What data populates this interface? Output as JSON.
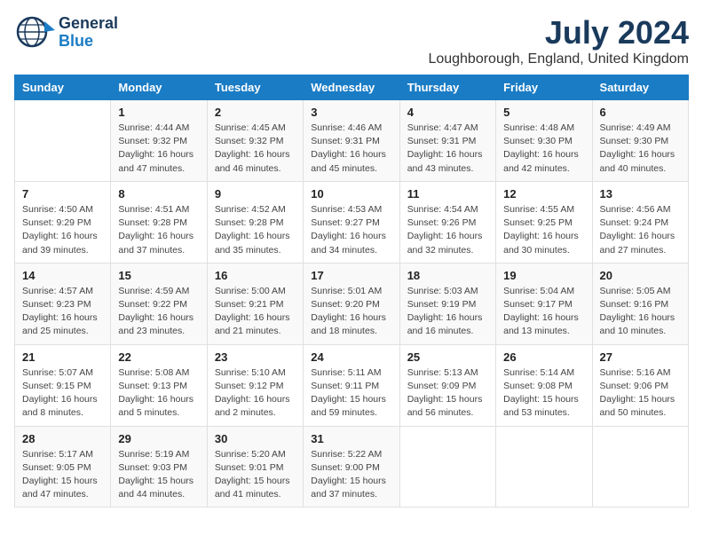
{
  "header": {
    "logo_line1": "General",
    "logo_line2": "Blue",
    "month": "July 2024",
    "location": "Loughborough, England, United Kingdom"
  },
  "days_of_week": [
    "Sunday",
    "Monday",
    "Tuesday",
    "Wednesday",
    "Thursday",
    "Friday",
    "Saturday"
  ],
  "weeks": [
    [
      {
        "day": "",
        "info": ""
      },
      {
        "day": "1",
        "info": "Sunrise: 4:44 AM\nSunset: 9:32 PM\nDaylight: 16 hours\nand 47 minutes."
      },
      {
        "day": "2",
        "info": "Sunrise: 4:45 AM\nSunset: 9:32 PM\nDaylight: 16 hours\nand 46 minutes."
      },
      {
        "day": "3",
        "info": "Sunrise: 4:46 AM\nSunset: 9:31 PM\nDaylight: 16 hours\nand 45 minutes."
      },
      {
        "day": "4",
        "info": "Sunrise: 4:47 AM\nSunset: 9:31 PM\nDaylight: 16 hours\nand 43 minutes."
      },
      {
        "day": "5",
        "info": "Sunrise: 4:48 AM\nSunset: 9:30 PM\nDaylight: 16 hours\nand 42 minutes."
      },
      {
        "day": "6",
        "info": "Sunrise: 4:49 AM\nSunset: 9:30 PM\nDaylight: 16 hours\nand 40 minutes."
      }
    ],
    [
      {
        "day": "7",
        "info": "Sunrise: 4:50 AM\nSunset: 9:29 PM\nDaylight: 16 hours\nand 39 minutes."
      },
      {
        "day": "8",
        "info": "Sunrise: 4:51 AM\nSunset: 9:28 PM\nDaylight: 16 hours\nand 37 minutes."
      },
      {
        "day": "9",
        "info": "Sunrise: 4:52 AM\nSunset: 9:28 PM\nDaylight: 16 hours\nand 35 minutes."
      },
      {
        "day": "10",
        "info": "Sunrise: 4:53 AM\nSunset: 9:27 PM\nDaylight: 16 hours\nand 34 minutes."
      },
      {
        "day": "11",
        "info": "Sunrise: 4:54 AM\nSunset: 9:26 PM\nDaylight: 16 hours\nand 32 minutes."
      },
      {
        "day": "12",
        "info": "Sunrise: 4:55 AM\nSunset: 9:25 PM\nDaylight: 16 hours\nand 30 minutes."
      },
      {
        "day": "13",
        "info": "Sunrise: 4:56 AM\nSunset: 9:24 PM\nDaylight: 16 hours\nand 27 minutes."
      }
    ],
    [
      {
        "day": "14",
        "info": "Sunrise: 4:57 AM\nSunset: 9:23 PM\nDaylight: 16 hours\nand 25 minutes."
      },
      {
        "day": "15",
        "info": "Sunrise: 4:59 AM\nSunset: 9:22 PM\nDaylight: 16 hours\nand 23 minutes."
      },
      {
        "day": "16",
        "info": "Sunrise: 5:00 AM\nSunset: 9:21 PM\nDaylight: 16 hours\nand 21 minutes."
      },
      {
        "day": "17",
        "info": "Sunrise: 5:01 AM\nSunset: 9:20 PM\nDaylight: 16 hours\nand 18 minutes."
      },
      {
        "day": "18",
        "info": "Sunrise: 5:03 AM\nSunset: 9:19 PM\nDaylight: 16 hours\nand 16 minutes."
      },
      {
        "day": "19",
        "info": "Sunrise: 5:04 AM\nSunset: 9:17 PM\nDaylight: 16 hours\nand 13 minutes."
      },
      {
        "day": "20",
        "info": "Sunrise: 5:05 AM\nSunset: 9:16 PM\nDaylight: 16 hours\nand 10 minutes."
      }
    ],
    [
      {
        "day": "21",
        "info": "Sunrise: 5:07 AM\nSunset: 9:15 PM\nDaylight: 16 hours\nand 8 minutes."
      },
      {
        "day": "22",
        "info": "Sunrise: 5:08 AM\nSunset: 9:13 PM\nDaylight: 16 hours\nand 5 minutes."
      },
      {
        "day": "23",
        "info": "Sunrise: 5:10 AM\nSunset: 9:12 PM\nDaylight: 16 hours\nand 2 minutes."
      },
      {
        "day": "24",
        "info": "Sunrise: 5:11 AM\nSunset: 9:11 PM\nDaylight: 15 hours\nand 59 minutes."
      },
      {
        "day": "25",
        "info": "Sunrise: 5:13 AM\nSunset: 9:09 PM\nDaylight: 15 hours\nand 56 minutes."
      },
      {
        "day": "26",
        "info": "Sunrise: 5:14 AM\nSunset: 9:08 PM\nDaylight: 15 hours\nand 53 minutes."
      },
      {
        "day": "27",
        "info": "Sunrise: 5:16 AM\nSunset: 9:06 PM\nDaylight: 15 hours\nand 50 minutes."
      }
    ],
    [
      {
        "day": "28",
        "info": "Sunrise: 5:17 AM\nSunset: 9:05 PM\nDaylight: 15 hours\nand 47 minutes."
      },
      {
        "day": "29",
        "info": "Sunrise: 5:19 AM\nSunset: 9:03 PM\nDaylight: 15 hours\nand 44 minutes."
      },
      {
        "day": "30",
        "info": "Sunrise: 5:20 AM\nSunset: 9:01 PM\nDaylight: 15 hours\nand 41 minutes."
      },
      {
        "day": "31",
        "info": "Sunrise: 5:22 AM\nSunset: 9:00 PM\nDaylight: 15 hours\nand 37 minutes."
      },
      {
        "day": "",
        "info": ""
      },
      {
        "day": "",
        "info": ""
      },
      {
        "day": "",
        "info": ""
      }
    ]
  ]
}
